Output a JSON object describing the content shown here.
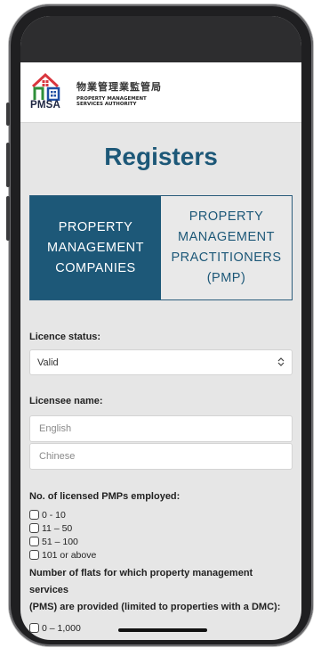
{
  "header": {
    "logo_cn": "物業管理業監管局",
    "logo_en_line1": "PROPERTY MANAGEMENT",
    "logo_en_line2": "SERVICES AUTHORITY",
    "logo_abbr": "PMSA"
  },
  "page": {
    "title": "Registers"
  },
  "tabs": [
    {
      "lines": [
        "PROPERTY",
        "MANAGEMENT",
        "COMPANIES"
      ],
      "active": true
    },
    {
      "lines": [
        "PROPERTY",
        "MANAGEMENT",
        "PRACTITIONERS",
        "(PMP)"
      ],
      "active": false
    }
  ],
  "filters": {
    "licence_status": {
      "label": "Licence status:",
      "value": "Valid"
    },
    "licensee_name": {
      "label": "Licensee name:",
      "english_placeholder": "English",
      "chinese_placeholder": "Chinese"
    },
    "pmps_employed": {
      "label": "No. of licensed PMPs employed:",
      "options": [
        "0 - 10",
        "11 – 50",
        "51 – 100",
        "101 or above"
      ]
    },
    "flats": {
      "label_line1": "Number of flats for which property management services",
      "label_line2": "(PMS) are provided (limited to properties with a DMC):",
      "options": [
        "0 – 1,000"
      ]
    }
  },
  "colors": {
    "accent": "#1d5878",
    "logo_red": "#d9363e",
    "logo_green": "#2f8f3a",
    "logo_blue": "#1f4fa3"
  },
  "icons": {
    "select_arrow": "chevron-up-down-icon"
  }
}
